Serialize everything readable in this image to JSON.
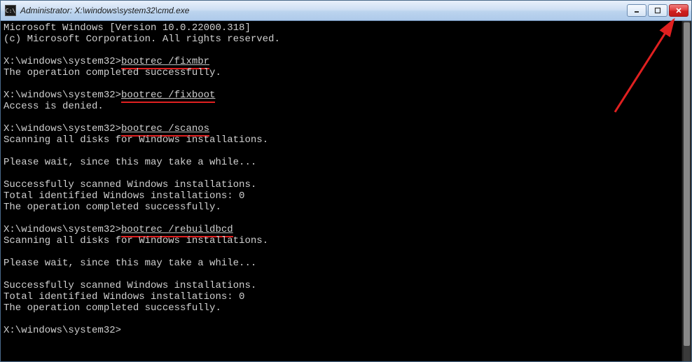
{
  "titlebar": {
    "icon_label": "C:\\",
    "title": "Administrator: X:\\windows\\system32\\cmd.exe",
    "buttons": {
      "minimize": "Minimize",
      "maximize": "Maximize",
      "close": "Close"
    }
  },
  "annotation": {
    "arrow_target": "close-button"
  },
  "terminal": {
    "header_line1": "Microsoft Windows [Version 10.0.22000.318]",
    "header_line2": "(c) Microsoft Corporation. All rights reserved.",
    "prompt": "X:\\windows\\system32>",
    "entries": [
      {
        "command": "bootrec /fixmbr",
        "highlight": true,
        "output": [
          "The operation completed successfully."
        ]
      },
      {
        "command": "bootrec /fixboot",
        "highlight": true,
        "output": [
          "Access is denied."
        ]
      },
      {
        "command": "bootrec /scanos",
        "highlight": true,
        "output": [
          "Scanning all disks for Windows installations.",
          "",
          "Please wait, since this may take a while...",
          "",
          "Successfully scanned Windows installations.",
          "Total identified Windows installations: 0",
          "The operation completed successfully."
        ]
      },
      {
        "command": "bootrec /rebuildbcd",
        "highlight": true,
        "output": [
          "Scanning all disks for Windows installations.",
          "",
          "Please wait, since this may take a while...",
          "",
          "Successfully scanned Windows installations.",
          "Total identified Windows installations: 0",
          "The operation completed successfully."
        ]
      },
      {
        "command": "",
        "highlight": false,
        "output": []
      }
    ]
  }
}
